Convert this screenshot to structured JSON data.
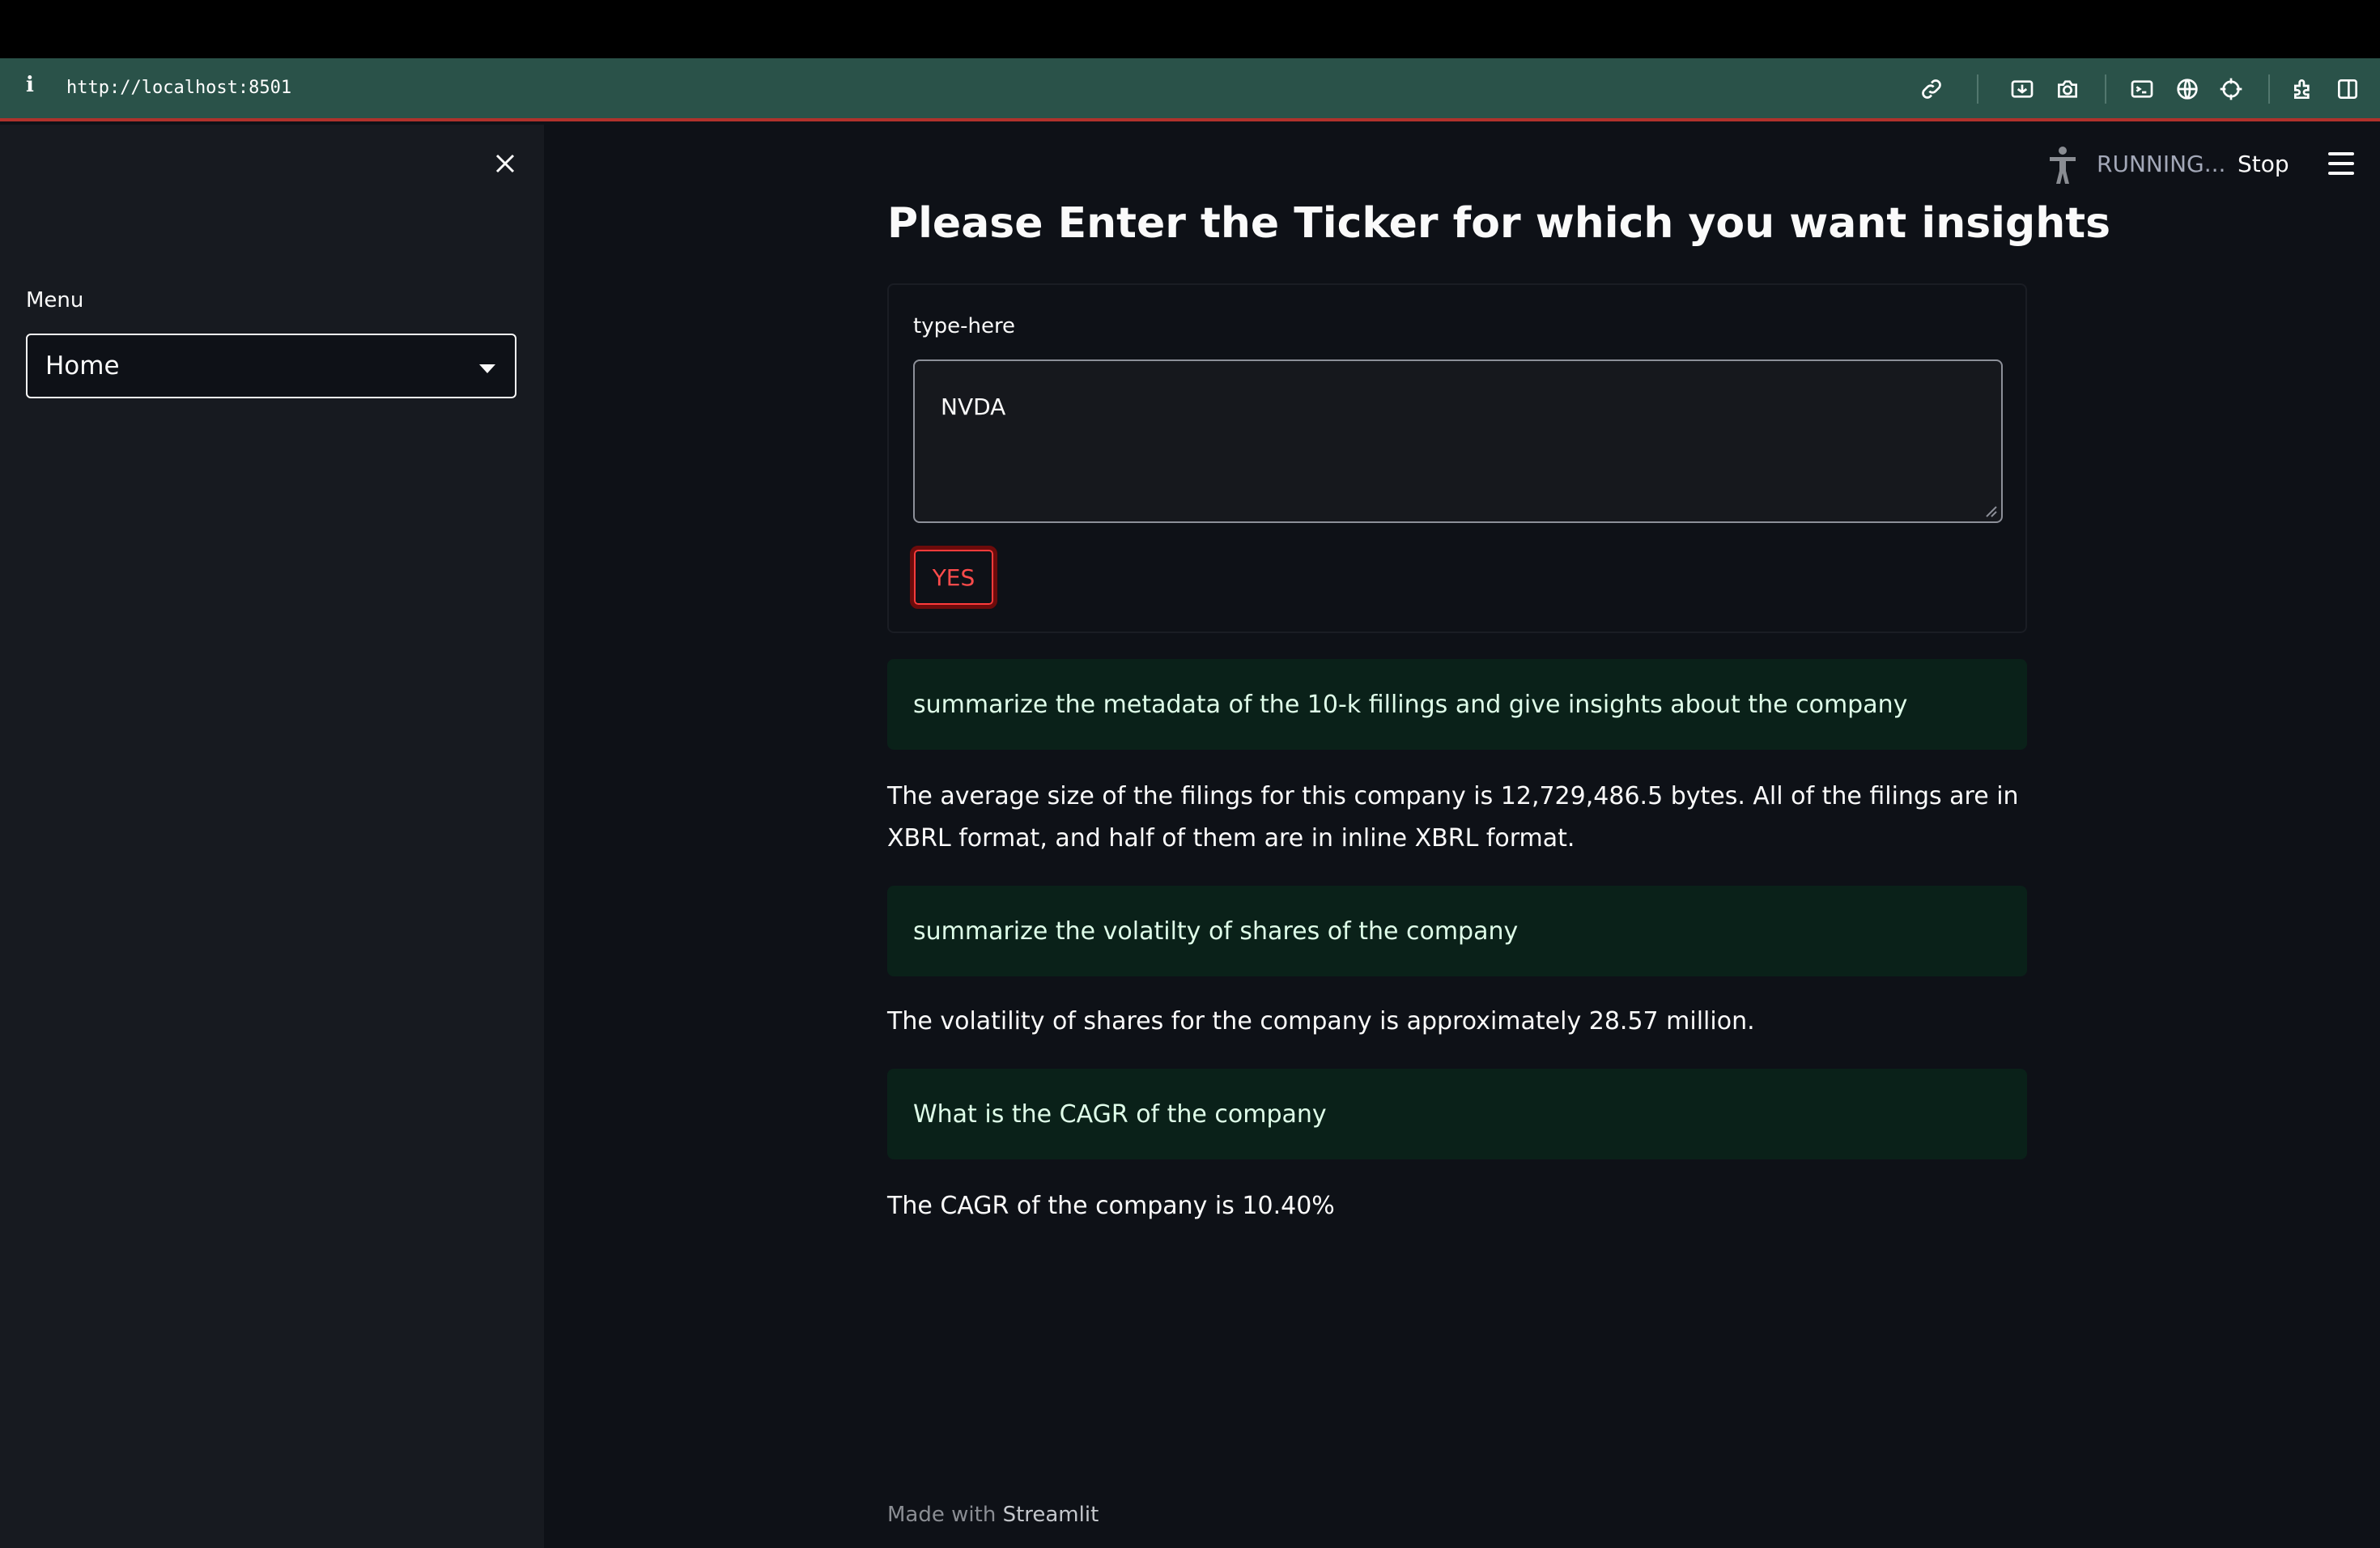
{
  "browser": {
    "url": "http://localhost:8501",
    "info_glyph": "i",
    "toolbar_icons": [
      "link-icon",
      "screenshot-icon",
      "camera-icon",
      "terminal-icon",
      "globe-icon",
      "crosshair-icon",
      "extensions-icon",
      "split-view-icon"
    ]
  },
  "sidebar": {
    "menu_label": "Menu",
    "menu_selected": "Home"
  },
  "header": {
    "status": "RUNNING...",
    "stop_label": "Stop"
  },
  "main": {
    "title": "Please Enter the Ticker for which you want insights",
    "input_label": "type-here",
    "input_value": "NVDA",
    "submit_label": "YES",
    "qa": [
      {
        "question": "summarize the metadata of the 10-k fillings and give insights about the company",
        "answer": "The average size of the filings for this company is 12,729,486.5 bytes. All of the filings are in XBRL format, and half of them are in inline XBRL format."
      },
      {
        "question": "summarize the volatilty of shares of the company",
        "answer": "The volatility of shares for the company is approximately 28.57 million."
      },
      {
        "question": "What is the CAGR of the company",
        "answer": "The CAGR of the company is 10.40%"
      }
    ]
  },
  "footer": {
    "prefix": "Made with",
    "brand": "Streamlit"
  },
  "colors": {
    "background": "#0e1117",
    "sidebar": "#171a20",
    "url_bar": "#2a5249",
    "question_box": "#0a2119",
    "accent_red": "#ff4b4b"
  }
}
